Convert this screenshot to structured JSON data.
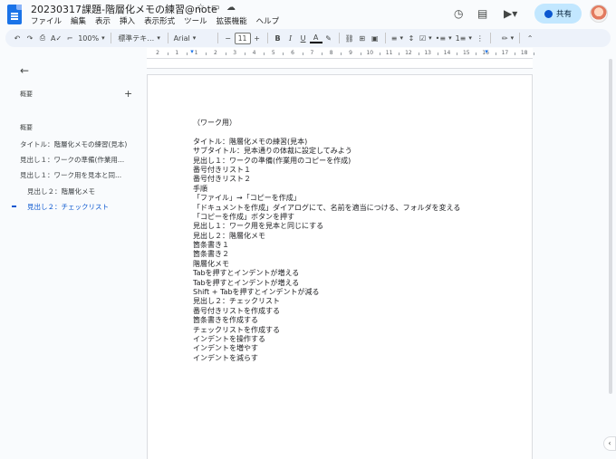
{
  "window": {
    "doc_title": "20230317課題-階層化メモの練習@note",
    "menu": [
      "ファイル",
      "編集",
      "表示",
      "挿入",
      "表示形式",
      "ツール",
      "拡張機能",
      "ヘルプ"
    ],
    "share_label": "共有"
  },
  "toolbar": {
    "zoom": "100%",
    "style": "標準テキ…",
    "font": "Arial",
    "font_size": "11"
  },
  "ruler": {
    "numbers": [
      "2",
      "1",
      "1",
      "2",
      "3",
      "4",
      "5",
      "6",
      "7",
      "8",
      "9",
      "10",
      "11",
      "12",
      "13",
      "14",
      "15",
      "16",
      "17",
      "18"
    ]
  },
  "outline": {
    "summary_label": "概要",
    "outline_label": "概要",
    "items": [
      {
        "label": "タイトル：階層化メモの練習(見本)"
      },
      {
        "label": "見出し１：ワークの準備(作業用..."
      },
      {
        "label": "見出し１：ワーク用を見本と同..."
      },
      {
        "label": "見出し２：階層化メモ"
      },
      {
        "label": "見出し２：チェックリスト"
      }
    ]
  },
  "document": {
    "first_line": "（ワーク用）",
    "lines": [
      "タイトル：階層化メモの練習(見本)",
      "サブタイトル：見本通りの体裁に設定してみよう",
      "見出し１：ワークの準備(作業用のコピーを作成)",
      "番号付きリスト１",
      "番号付きリスト２",
      "手順",
      "「ファイル」→「コピーを作成」",
      "「ドキュメントを作成」ダイアログにて、名前を適当につける、フォルダを変える",
      "「コピーを作成」ボタンを押す",
      "見出し１：ワーク用を見本と同じにする",
      "見出し２：階層化メモ",
      "箇条書き１",
      "箇条書き２",
      "階層化メモ",
      "Tabを押すとインデントが増える",
      "Tabを押すとインデントが増える",
      "Shift + Tabを押すとインデントが減る",
      "見出し２：チェックリスト",
      "番号付きリストを作成する",
      "箇条書きを作成する",
      "チェックリストを作成する",
      "インデントを操作する",
      "インデントを増やす",
      "インデントを減らす"
    ]
  },
  "colors": {
    "accent": "#0b57d0",
    "share_bg": "#c2e7ff",
    "toolbar_bg": "#edf2fa"
  }
}
